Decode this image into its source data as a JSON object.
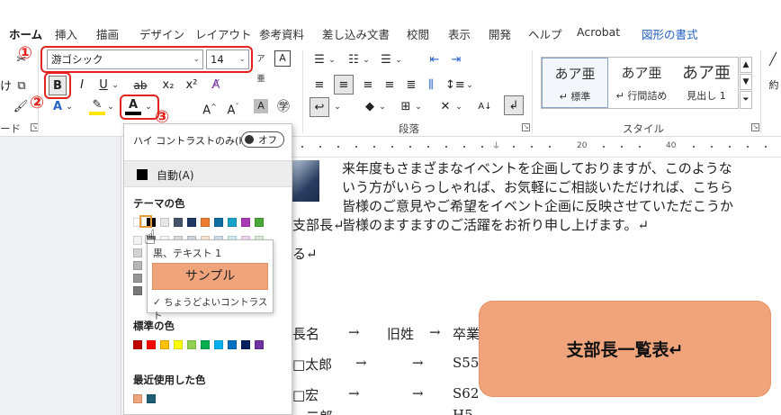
{
  "tabs": [
    "ホーム",
    "挿入",
    "描画",
    "デザイン",
    "レイアウト",
    "参考資料",
    "差し込み文書",
    "校閲",
    "表示",
    "開発",
    "ヘルプ",
    "Acrobat",
    "図形の書式"
  ],
  "font": {
    "name": "游ゴシック",
    "size": "14"
  },
  "buttons": {
    "bold": "B",
    "italic": "I",
    "underline": "U",
    "strike": "ab",
    "subscript": "x₂",
    "superscript": "x²",
    "font_color": "A",
    "grow": "A^",
    "shrink": "Aˇ",
    "char_shade": "A"
  },
  "markers": {
    "one": "①",
    "two": "②",
    "three": "③"
  },
  "groups": {
    "paragraph": "段落",
    "style": "スタイル",
    "font_short": "ード"
  },
  "styles": [
    {
      "name": "あア亜",
      "label": "↵ 標準"
    },
    {
      "name": "あア亜",
      "label": "↵ 行間詰め"
    },
    {
      "name": "あア亜",
      "label": "見出し 1"
    }
  ],
  "style_partial": "約",
  "ruler_labels": [
    "20",
    "40"
  ],
  "document": {
    "lines": [
      "来年度もさまざまなイベントを企画しておりますが、このような",
      "いう方がいらっしゃれば、お気軽にご相談いただければ、こちら",
      "皆様のご意見やご希望をイベント企画に反映させていただこうか",
      "皆様のますますのご活躍をお祈り申し上げます。↵"
    ],
    "left_fragments": [
      "支部長↵",
      "る↵"
    ],
    "table_rows": [
      [
        "長名",
        "→",
        "旧姓",
        "→",
        "卒業"
      ],
      [
        "□太郎",
        "→",
        "→",
        "S55"
      ],
      [
        "□宏",
        "→",
        "→",
        "S62"
      ],
      [
        "二郎",
        "",
        "",
        "H5"
      ]
    ],
    "shape_text": "支部長一覧表↵"
  },
  "dropdown": {
    "high_contrast_label": "ハイ コントラストのみ(H)",
    "toggle_label": "オフ",
    "auto_label": "自動(A)",
    "theme_title": "テーマの色",
    "theme_colors": [
      "#ffffff",
      "#000000",
      "#e7e6e6",
      "#44546a",
      "#1f3864",
      "#ed7d31",
      "#0f6fa0",
      "#1aa3c9",
      "#a83bb5",
      "#4aa83a"
    ],
    "standard_title": "標準の色",
    "standard_colors": [
      "#c00000",
      "#ff0000",
      "#ffc000",
      "#ffff00",
      "#92d050",
      "#00b050",
      "#00b0f0",
      "#0070c0",
      "#002060",
      "#7030a0"
    ],
    "recent_title": "最近使用した色",
    "recent_colors": [
      "#f0a47c",
      "#1e5f75"
    ],
    "tooltip_name": "黒、テキスト 1",
    "tooltip_sample": "サンプル",
    "tooltip_check": "✓ ちょうどよいコントラスト"
  }
}
